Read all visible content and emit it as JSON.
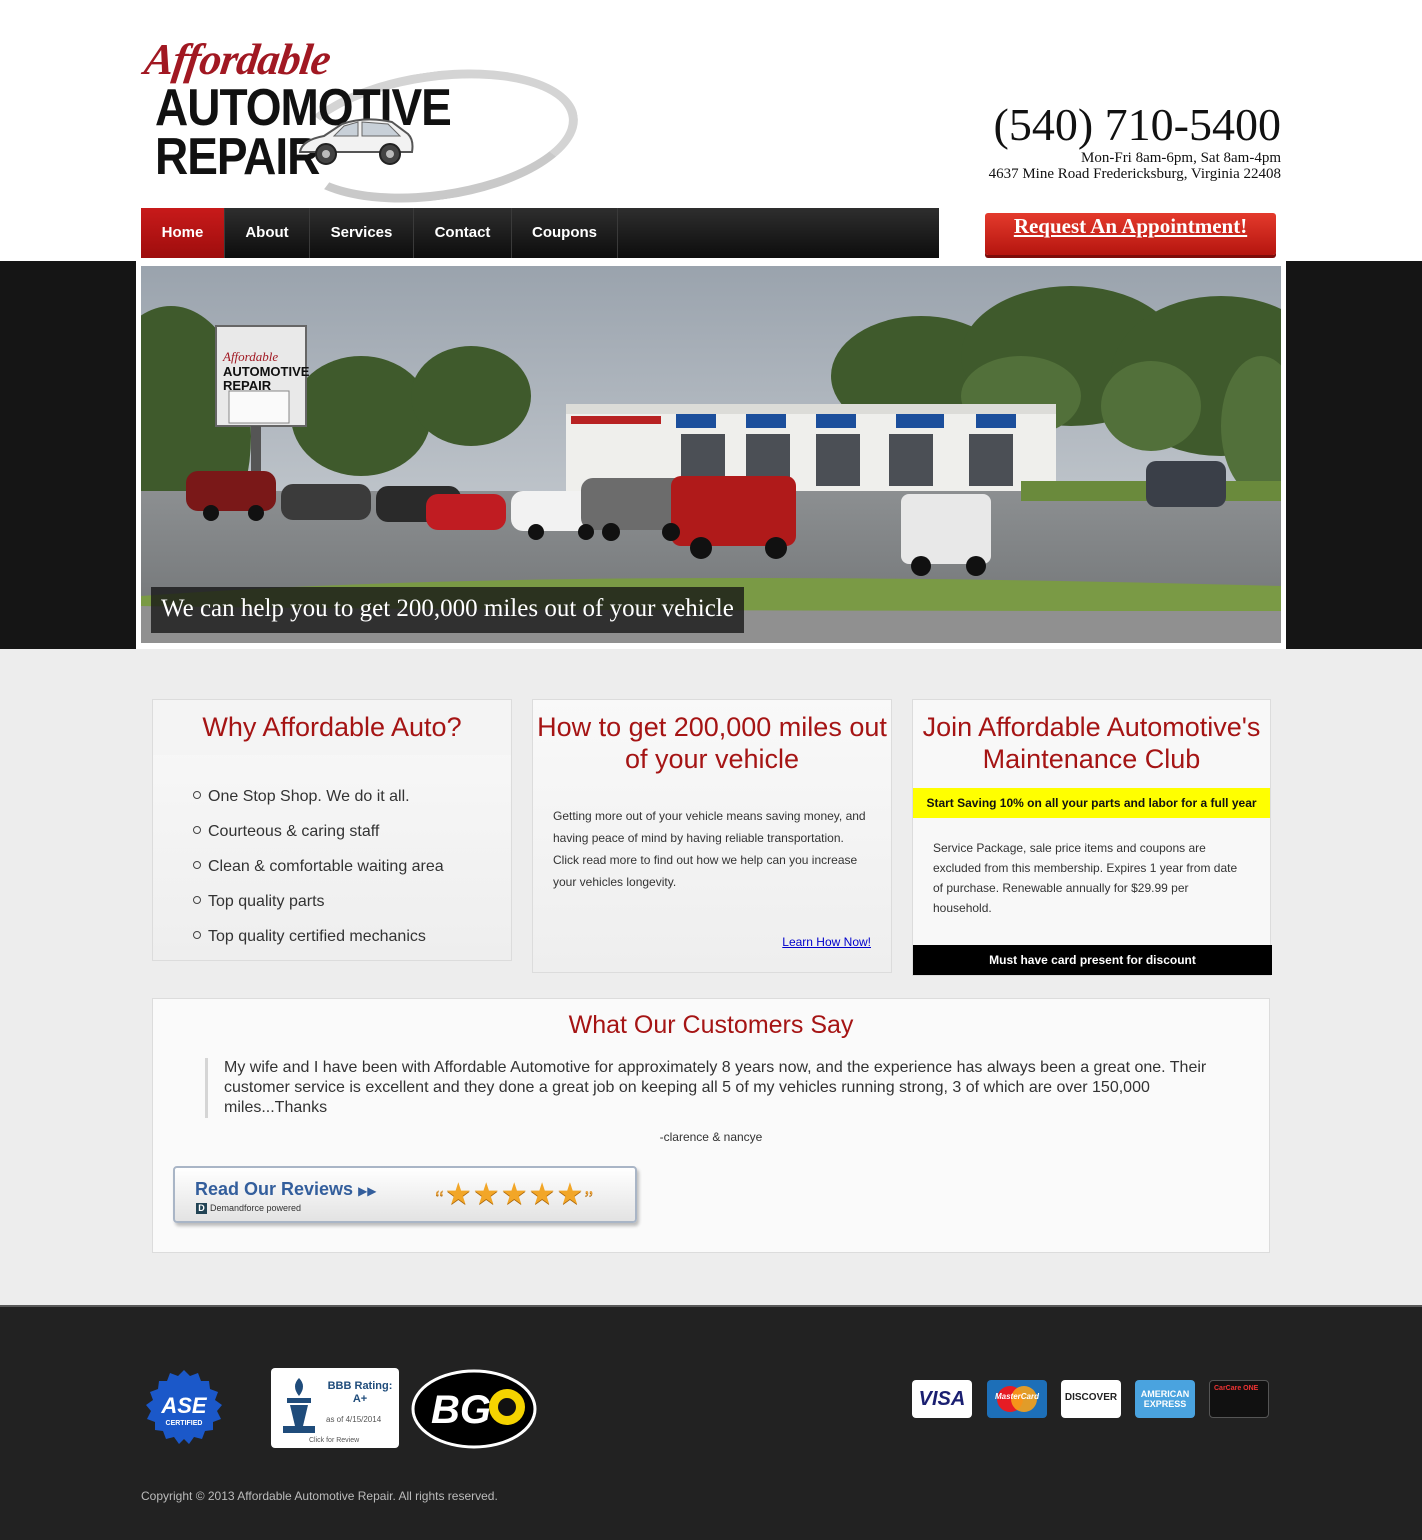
{
  "header": {
    "logo": {
      "line1": "Affordable",
      "line2": "AUTOMOTIVE",
      "line3": "REPAIR"
    },
    "phone": "(540) 710-5400",
    "hours": "Mon-Fri 8am-6pm, Sat 8am-4pm",
    "address": "4637 Mine Road Fredericksburg, Virginia 22408",
    "appointment_label": "Request An Appointment!"
  },
  "nav": {
    "items": [
      {
        "label": "Home",
        "active": true
      },
      {
        "label": "About",
        "active": false
      },
      {
        "label": "Services",
        "active": false
      },
      {
        "label": "Contact",
        "active": false
      },
      {
        "label": "Coupons",
        "active": false
      }
    ]
  },
  "hero": {
    "caption": "We can help you to get 200,000 miles out of your vehicle",
    "sign_line1": "Affordable",
    "sign_line2": "AUTOMOTIVE",
    "sign_line3": "REPAIR"
  },
  "why": {
    "title": "Why Affordable Auto?",
    "items": [
      "One Stop Shop. We do it all.",
      "Courteous & caring staff",
      "Clean & comfortable waiting area",
      "Top quality parts",
      "Top quality certified mechanics"
    ]
  },
  "howto": {
    "title": "How to get 200,000 miles out of your vehicle",
    "body": "Getting more out of your vehicle means saving money, and having peace of mind by having reliable transportation. Click read more to find out how we help can you increase your vehicles longevity.",
    "link": "Learn How Now!"
  },
  "club": {
    "title": "Join Affordable Automotive's Maintenance Club",
    "promo": "Start Saving 10% on all your parts and labor for a full year",
    "body": "Service Package, sale price items and coupons are excluded from this membership. Expires 1 year from date of purchase. Renewable annually for $29.99 per household.",
    "card_note": "Must have card present for discount"
  },
  "testimonials": {
    "title": "What Our Customers Say",
    "quote": "My wife and I have been with Affordable Automotive for approximately 8 years now, and the experience has always been a great one. Their customer service is excellent and they done a great job on keeping all 5 of my vehicles running strong, 3 of which are over 150,000 miles...Thanks",
    "author": "-clarence & nancye",
    "reviews_label": "Read Our Reviews",
    "reviews_powered": "Demandforce powered",
    "stars": 5
  },
  "footer": {
    "ase": {
      "line1": "ASE",
      "line2": "CERTIFIED"
    },
    "bbb": {
      "rating": "BBB Rating: A+",
      "date": "as of 4/15/2014",
      "note": "Click for Review"
    },
    "bg_logo": "BG",
    "payments": [
      "VISA",
      "MasterCard",
      "DISCOVER",
      "AMERICAN EXPRESS",
      "CarCare ONE"
    ],
    "copyright": "Copyright © 2013 Affordable Automotive Repair. All rights reserved."
  },
  "colors": {
    "brand_red": "#a51414",
    "nav_active": "#c81a1a",
    "promo_yellow": "#ffff00"
  }
}
